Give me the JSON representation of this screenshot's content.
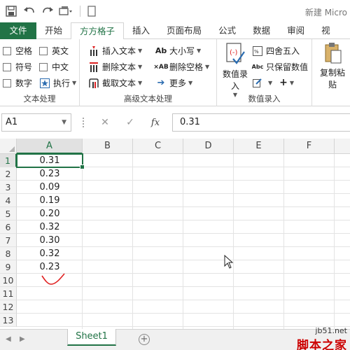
{
  "window": {
    "title": "新建 Micro"
  },
  "ribbon_tabs": [
    "文件",
    "开始",
    "方方格子",
    "插入",
    "页面布局",
    "公式",
    "数据",
    "审阅",
    "视"
  ],
  "active_tab_index": 2,
  "groups": {
    "text_processing": {
      "label": "文本处理",
      "checkboxes": [
        "空格",
        "英文",
        "符号",
        "中文",
        "数字"
      ],
      "execute_label": "执行"
    },
    "advanced_text": {
      "label": "高级文本处理",
      "items": [
        "插入文本",
        "删除文本",
        "截取文本",
        "大小写",
        "删除空格",
        "更多"
      ]
    },
    "numeric_input": {
      "label": "数值录入",
      "big_button": "数值录入",
      "items": [
        "四舍五入",
        "只保留数值"
      ]
    },
    "copy_paste": {
      "big_button": "复制粘贴"
    }
  },
  "formula_bar": {
    "name_box": "A1",
    "fx": "fx",
    "value": "0.31"
  },
  "columns": [
    "A",
    "B",
    "C",
    "D",
    "E",
    "F"
  ],
  "rows": [
    "1",
    "2",
    "3",
    "4",
    "5",
    "6",
    "7",
    "8",
    "9",
    "10",
    "11",
    "12",
    "13"
  ],
  "cells_A": [
    "0.31",
    "0.23",
    "0.09",
    "0.19",
    "0.20",
    "0.32",
    "0.30",
    "0.32",
    "0.23"
  ],
  "sheet_tabs": [
    "Sheet1"
  ],
  "watermark": {
    "line1": "jb51.net",
    "line2": "脚本之家"
  },
  "colors": {
    "accent": "#217346",
    "annotation": "#e02020"
  }
}
